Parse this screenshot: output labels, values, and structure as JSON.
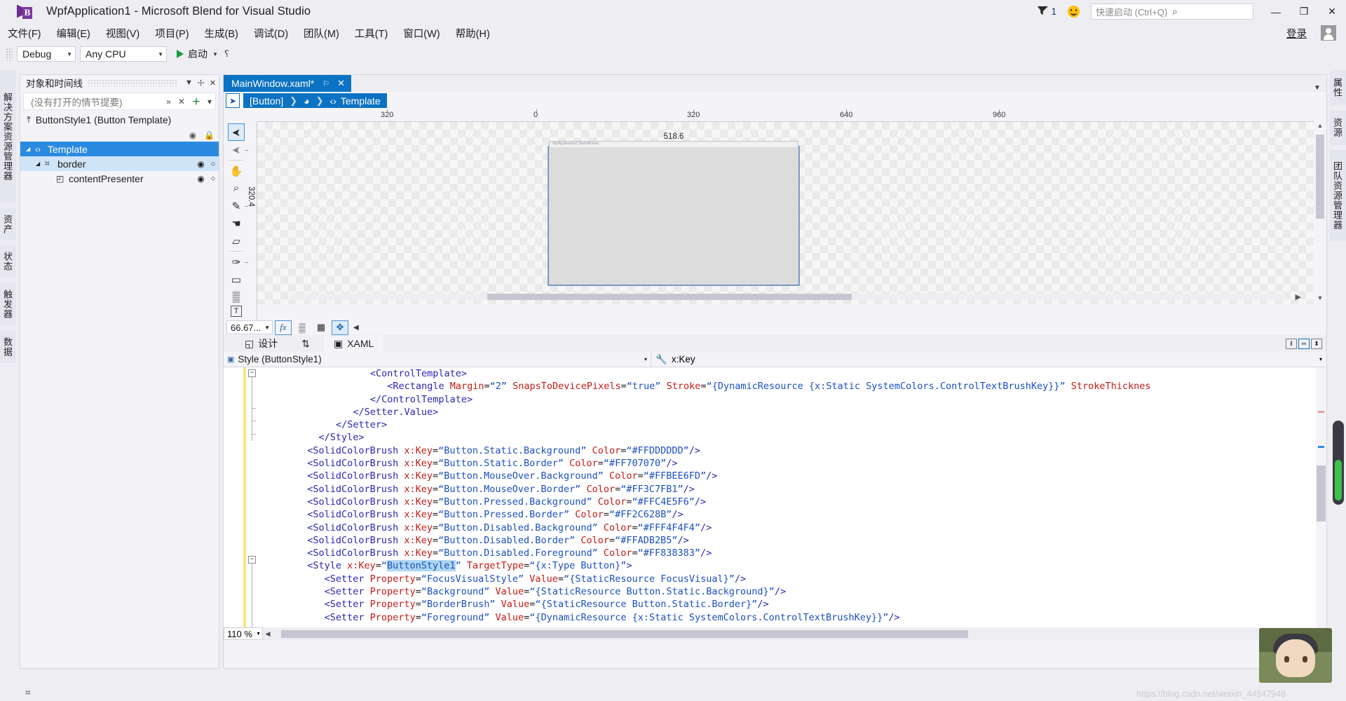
{
  "window": {
    "title": "WpfApplication1 - Microsoft Blend for Visual Studio",
    "logo_letter": "B",
    "notification_count": "1",
    "minimize": "—",
    "restore": "❐",
    "close": "✕"
  },
  "quick_launch": {
    "placeholder": "快速启动 (Ctrl+Q)",
    "search_icon": "⌕"
  },
  "menu": {
    "items": [
      "文件(F)",
      "编辑(E)",
      "视图(V)",
      "项目(P)",
      "生成(B)",
      "调试(D)",
      "团队(M)",
      "工具(T)",
      "窗口(W)",
      "帮助(H)"
    ],
    "sign_in": "登录"
  },
  "toolbar": {
    "configuration": "Debug",
    "platform": "Any CPU",
    "run_label": "启动",
    "overflow": "⸮"
  },
  "left_rail": {
    "tabs": [
      "解决方案资源管理器",
      "资产",
      "状态",
      "触发器",
      "数据"
    ]
  },
  "right_rail": {
    "tabs": [
      "属性",
      "资源",
      "团队资源管理器"
    ]
  },
  "objects_panel": {
    "title": "对象和时间线",
    "header_icons": [
      "▼",
      "☩",
      "✕"
    ],
    "search_placeholder": "(没有打开的情节提要)",
    "search_icons": [
      "»",
      "✕",
      "＋",
      "▾"
    ],
    "root_item": "ButtonStyle1 (Button Template)",
    "root_icon": "⤒",
    "eye_icon": "◉",
    "lock_icon": "ὑ2",
    "tree": [
      {
        "label": "Template",
        "icon": "‹›",
        "expander": "◢",
        "depth": 0,
        "selected": true,
        "eye": "",
        "lock": ""
      },
      {
        "label": "border",
        "icon": "⌗",
        "expander": "◢",
        "depth": 1,
        "selected": false,
        "sub": true,
        "eye": "◉",
        "lock": "○"
      },
      {
        "label": "contentPresenter",
        "icon": "◰",
        "expander": "",
        "depth": 2,
        "selected": false,
        "eye": "◉",
        "lock": "○"
      }
    ]
  },
  "document": {
    "tab_label": "MainWindow.xaml*",
    "tab_pin": "⚐",
    "tab_close": "✕",
    "breadcrumb": [
      {
        "label": "[Button]",
        "icon": ""
      },
      {
        "label": "",
        "icon": "◕"
      },
      {
        "label": "Template",
        "icon": "‹›"
      }
    ],
    "breadcrumb_sep": "❯",
    "select_tool_icon": "➤"
  },
  "canvas": {
    "ruler_labels_h": [
      "320",
      "0",
      "320",
      "640",
      "960"
    ],
    "artboard_width_label": "518.6",
    "artboard_height_label": "320.4",
    "artboard_header_text": "WpfApplication1 MainWindow",
    "tools": [
      "selection-tool",
      "direct-selection-tool",
      "pan-tool",
      "zoom-tool",
      "eyedropper-tool",
      "paint-bucket-tool",
      "eraser-tool",
      "pen-tool",
      "rectangle-tool",
      "grid-tool",
      "text-tool"
    ],
    "tool_glyphs": [
      "➤",
      "➤",
      "✋",
      "⌕",
      "✎",
      "☚",
      "▱",
      "✑",
      "▭",
      "▒",
      "T"
    ],
    "zoom_value": "66.67...",
    "zoom_buttons": [
      "fx",
      "▒",
      "▦",
      "✥"
    ],
    "scroll_right_arrow": "▶"
  },
  "view_tabs": {
    "design": "设计",
    "design_icon": "◱",
    "swap_icon": "⇅",
    "xaml": "XAML",
    "xaml_icon": "▣",
    "split_buttons": [
      "‖",
      "═",
      "⬍"
    ]
  },
  "code_editor": {
    "scope_left_icon": "▣",
    "scope_left": "Style (ButtonStyle1)",
    "scope_right_icon": "🔧",
    "scope_right": "x:Key",
    "dropdown_arrow": "▾",
    "zoom_percent": "110 %",
    "selected_token": "ButtonStyle1",
    "lines": [
      {
        "indent": 19,
        "html": "<span class=\"t-tag\">&lt;ControlTemplate&gt;</span>"
      },
      {
        "indent": 22,
        "html": "<span class=\"t-tag\">&lt;Rectangle </span><span class=\"t-attr\">Margin</span><span class=\"t-plain\">=</span><span class=\"t-val\">“2”</span><span class=\"t-plain\"> </span><span class=\"t-attr\">SnapsToDevicePixels</span><span class=\"t-plain\">=</span><span class=\"t-val\">“true”</span><span class=\"t-plain\"> </span><span class=\"t-attr\">Stroke</span><span class=\"t-plain\">=</span><span class=\"t-val\">“{DynamicResource {x:Static SystemColors.ControlTextBrushKey}}”</span><span class=\"t-plain\"> </span><span class=\"t-attr\">StrokeThicknes</span>"
      },
      {
        "indent": 19,
        "html": "<span class=\"t-tag\">&lt;/ControlTemplate&gt;</span>"
      },
      {
        "indent": 16,
        "html": "<span class=\"t-tag\">&lt;/Setter.Value&gt;</span>"
      },
      {
        "indent": 13,
        "html": "<span class=\"t-tag\">&lt;/Setter&gt;</span>"
      },
      {
        "indent": 10,
        "html": "<span class=\"t-tag\">&lt;/Style&gt;</span>"
      },
      {
        "indent": 8,
        "html": "<span class=\"t-tag\">&lt;SolidColorBrush </span><span class=\"t-attr\">x:Key</span><span class=\"t-plain\">=</span><span class=\"t-val\">“Button.Static.Background”</span><span class=\"t-plain\"> </span><span class=\"t-attr\">Color</span><span class=\"t-plain\">=</span><span class=\"t-val\">“#FFDDDDDD”</span><span class=\"t-tag\">/&gt;</span>"
      },
      {
        "indent": 8,
        "html": "<span class=\"t-tag\">&lt;SolidColorBrush </span><span class=\"t-attr\">x:Key</span><span class=\"t-plain\">=</span><span class=\"t-val\">“Button.Static.Border”</span><span class=\"t-plain\"> </span><span class=\"t-attr\">Color</span><span class=\"t-plain\">=</span><span class=\"t-val\">“#FF707070”</span><span class=\"t-tag\">/&gt;</span>"
      },
      {
        "indent": 8,
        "html": "<span class=\"t-tag\">&lt;SolidColorBrush </span><span class=\"t-attr\">x:Key</span><span class=\"t-plain\">=</span><span class=\"t-val\">“Button.MouseOver.Background”</span><span class=\"t-plain\"> </span><span class=\"t-attr\">Color</span><span class=\"t-plain\">=</span><span class=\"t-val\">“#FFBEE6FD”</span><span class=\"t-tag\">/&gt;</span>"
      },
      {
        "indent": 8,
        "html": "<span class=\"t-tag\">&lt;SolidColorBrush </span><span class=\"t-attr\">x:Key</span><span class=\"t-plain\">=</span><span class=\"t-val\">“Button.MouseOver.Border”</span><span class=\"t-plain\"> </span><span class=\"t-attr\">Color</span><span class=\"t-plain\">=</span><span class=\"t-val\">“#FF3C7FB1”</span><span class=\"t-tag\">/&gt;</span>"
      },
      {
        "indent": 8,
        "html": "<span class=\"t-tag\">&lt;SolidColorBrush </span><span class=\"t-attr\">x:Key</span><span class=\"t-plain\">=</span><span class=\"t-val\">“Button.Pressed.Background”</span><span class=\"t-plain\"> </span><span class=\"t-attr\">Color</span><span class=\"t-plain\">=</span><span class=\"t-val\">“#FFC4E5F6”</span><span class=\"t-tag\">/&gt;</span>"
      },
      {
        "indent": 8,
        "html": "<span class=\"t-tag\">&lt;SolidColorBrush </span><span class=\"t-attr\">x:Key</span><span class=\"t-plain\">=</span><span class=\"t-val\">“Button.Pressed.Border”</span><span class=\"t-plain\"> </span><span class=\"t-attr\">Color</span><span class=\"t-plain\">=</span><span class=\"t-val\">“#FF2C628B”</span><span class=\"t-tag\">/&gt;</span>"
      },
      {
        "indent": 8,
        "html": "<span class=\"t-tag\">&lt;SolidColorBrush </span><span class=\"t-attr\">x:Key</span><span class=\"t-plain\">=</span><span class=\"t-val\">“Button.Disabled.Background”</span><span class=\"t-plain\"> </span><span class=\"t-attr\">Color</span><span class=\"t-plain\">=</span><span class=\"t-val\">“#FFF4F4F4”</span><span class=\"t-tag\">/&gt;</span>"
      },
      {
        "indent": 8,
        "html": "<span class=\"t-tag\">&lt;SolidColorBrush </span><span class=\"t-attr\">x:Key</span><span class=\"t-plain\">=</span><span class=\"t-val\">“Button.Disabled.Border”</span><span class=\"t-plain\"> </span><span class=\"t-attr\">Color</span><span class=\"t-plain\">=</span><span class=\"t-val\">“#FFADB2B5”</span><span class=\"t-tag\">/&gt;</span>"
      },
      {
        "indent": 8,
        "html": "<span class=\"t-tag\">&lt;SolidColorBrush </span><span class=\"t-attr\">x:Key</span><span class=\"t-plain\">=</span><span class=\"t-val\">“Button.Disabled.Foreground”</span><span class=\"t-plain\"> </span><span class=\"t-attr\">Color</span><span class=\"t-plain\">=</span><span class=\"t-val\">“#FF838383”</span><span class=\"t-tag\">/&gt;</span>"
      },
      {
        "indent": 8,
        "html": "<span class=\"t-tag\">&lt;Style </span><span class=\"t-attr\">x:Key</span><span class=\"t-plain\">=</span><span class=\"t-val\">“</span><span class=\"sel-hl t-val\">ButtonStyle1</span><span class=\"t-val\">”</span><span class=\"t-plain\"> </span><span class=\"t-attr\">TargetType</span><span class=\"t-plain\">=</span><span class=\"t-val\">“{x:Type Button}”</span><span class=\"t-tag\">&gt;</span>"
      },
      {
        "indent": 11,
        "html": "<span class=\"t-tag\">&lt;Setter </span><span class=\"t-attr\">Property</span><span class=\"t-plain\">=</span><span class=\"t-val\">“FocusVisualStyle”</span><span class=\"t-plain\"> </span><span class=\"t-attr\">Value</span><span class=\"t-plain\">=</span><span class=\"t-val\">“{StaticResource FocusVisual}”</span><span class=\"t-tag\">/&gt;</span>"
      },
      {
        "indent": 11,
        "html": "<span class=\"t-tag\">&lt;Setter </span><span class=\"t-attr\">Property</span><span class=\"t-plain\">=</span><span class=\"t-val\">“Background”</span><span class=\"t-plain\"> </span><span class=\"t-attr\">Value</span><span class=\"t-plain\">=</span><span class=\"t-val\">“{StaticResource Button.Static.Background}”</span><span class=\"t-tag\">/&gt;</span>"
      },
      {
        "indent": 11,
        "html": "<span class=\"t-tag\">&lt;Setter </span><span class=\"t-attr\">Property</span><span class=\"t-plain\">=</span><span class=\"t-val\">“BorderBrush”</span><span class=\"t-plain\"> </span><span class=\"t-attr\">Value</span><span class=\"t-plain\">=</span><span class=\"t-val\">“{StaticResource Button.Static.Border}”</span><span class=\"t-tag\">/&gt;</span>"
      },
      {
        "indent": 11,
        "html": "<span class=\"t-tag\">&lt;Setter </span><span class=\"t-attr\">Property</span><span class=\"t-plain\">=</span><span class=\"t-val\">“Foreground”</span><span class=\"t-plain\"> </span><span class=\"t-attr\">Value</span><span class=\"t-plain\">=</span><span class=\"t-val\">“{DynamicResource {x:Static SystemColors.ControlTextBrushKey}}”</span><span class=\"t-tag\">/&gt;</span>"
      }
    ]
  },
  "statusbar": {
    "icon": "⌗",
    "watermark": "https://blog.csdn.net/weixin_44547949"
  },
  "colors": {
    "accent": "#0c72c3",
    "selection": "#2a8ae0",
    "chrome": "#eeeef2",
    "panel": "#f4f4f8"
  }
}
